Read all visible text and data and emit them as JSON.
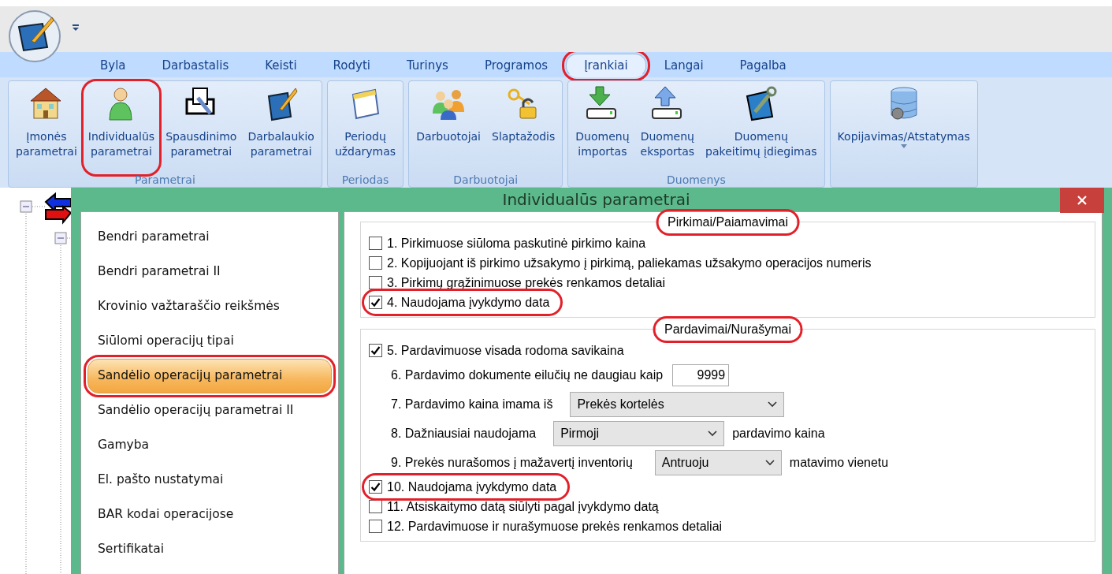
{
  "ribbon_tabs": [
    {
      "label": "Byla",
      "selected": false,
      "highlighted": false
    },
    {
      "label": "Darbastalis",
      "selected": false,
      "highlighted": false
    },
    {
      "label": "Keisti",
      "selected": false,
      "highlighted": false
    },
    {
      "label": "Rodyti",
      "selected": false,
      "highlighted": false
    },
    {
      "label": "Turinys",
      "selected": false,
      "highlighted": false
    },
    {
      "label": "Programos",
      "selected": false,
      "highlighted": false
    },
    {
      "label": "Įrankiai",
      "selected": true,
      "highlighted": true
    },
    {
      "label": "Langai",
      "selected": false,
      "highlighted": false
    },
    {
      "label": "Pagalba",
      "selected": false,
      "highlighted": false
    }
  ],
  "ribbon_groups": [
    {
      "label": "Parametrai",
      "buttons": [
        {
          "lines": [
            "Įmonės",
            "parametrai"
          ],
          "highlighted": false
        },
        {
          "lines": [
            "Individualūs",
            "parametrai"
          ],
          "highlighted": true
        },
        {
          "lines": [
            "Spausdinimo",
            "parametrai"
          ],
          "highlighted": false
        },
        {
          "lines": [
            "Darbalaukio",
            "parametrai"
          ],
          "highlighted": false
        }
      ]
    },
    {
      "label": "Periodas",
      "buttons": [
        {
          "lines": [
            "Periodų",
            "uždarymas"
          ],
          "highlighted": false
        }
      ]
    },
    {
      "label": "Darbuotojai",
      "buttons": [
        {
          "lines": [
            "Darbuotojai"
          ],
          "highlighted": false
        },
        {
          "lines": [
            "Slaptažodis"
          ],
          "highlighted": false
        }
      ]
    },
    {
      "label": "Duomenys",
      "buttons": [
        {
          "lines": [
            "Duomenų",
            "importas"
          ],
          "highlighted": false
        },
        {
          "lines": [
            "Duomenų",
            "eksportas"
          ],
          "highlighted": false
        },
        {
          "lines": [
            "Duomenų",
            "pakeitimų įdiegimas"
          ],
          "highlighted": false
        }
      ]
    },
    {
      "buttons": [
        {
          "lines": [
            "Kopijavimas/Atstatymas"
          ],
          "highlighted": false,
          "dropdown": true
        }
      ]
    }
  ],
  "dialog": {
    "title": "Individualūs parametrai",
    "sidebar": [
      {
        "label": "Bendri parametrai",
        "selected": false,
        "highlighted": false
      },
      {
        "label": "Bendri parametrai II",
        "selected": false,
        "highlighted": false
      },
      {
        "label": "Krovinio važtaraščio reikšmės",
        "selected": false,
        "highlighted": false
      },
      {
        "label": "Siūlomi operacijų tipai",
        "selected": false,
        "highlighted": false
      },
      {
        "label": "Sandėlio operacijų parametrai",
        "selected": true,
        "highlighted": true
      },
      {
        "label": "Sandėlio operacijų parametrai II",
        "selected": false,
        "highlighted": false
      },
      {
        "label": "Gamyba",
        "selected": false,
        "highlighted": false
      },
      {
        "label": "El. pašto nustatymai",
        "selected": false,
        "highlighted": false
      },
      {
        "label": "BAR kodai operacijose",
        "selected": false,
        "highlighted": false
      },
      {
        "label": "Sertifikatai",
        "selected": false,
        "highlighted": false
      }
    ],
    "groups": [
      {
        "legend": "Pirkimai/Paiamavimai",
        "highlighted": true,
        "rows": [
          {
            "kind": "checkbox",
            "label": "1. Pirkimuose siūloma paskutinė pirkimo kaina",
            "checked": false,
            "highlighted": false
          },
          {
            "kind": "checkbox",
            "label": "2. Kopijuojant iš pirkimo užsakymo į pirkimą, paliekamas užsakymo operacijos numeris",
            "checked": false,
            "highlighted": false
          },
          {
            "kind": "checkbox",
            "label": "3. Pirkimų grąžinimuose prekės renkamos detaliai",
            "checked": false,
            "highlighted": false
          },
          {
            "kind": "checkbox",
            "label": "4. Naudojama įvykdymo data",
            "checked": true,
            "highlighted": true
          }
        ]
      },
      {
        "legend": "Pardavimai/Nurašymai",
        "highlighted": true,
        "rows": [
          {
            "kind": "checkbox",
            "label": "5. Pardavimuose visada rodoma savikaina",
            "checked": true,
            "highlighted": false
          },
          {
            "kind": "number",
            "label": "6. Pardavimo dokumente eilučių ne daugiau kaip",
            "value": "9999"
          },
          {
            "kind": "select",
            "label": "7. Pardavimo kaina imama iš",
            "value": "Prekės kortelės"
          },
          {
            "kind": "select",
            "label": "8. Dažniausiai naudojama",
            "value": "Pirmoji",
            "suffix": "pardavimo kaina"
          },
          {
            "kind": "select",
            "label": "9. Prekės nurašomos į mažavertį inventorių",
            "value": "Antruoju",
            "suffix": "matavimo vienetu"
          },
          {
            "kind": "checkbox",
            "label": "10. Naudojama įvykdymo data",
            "checked": true,
            "highlighted": true
          },
          {
            "kind": "checkbox",
            "label": "11. Atsiskaitymo datą siūlyti pagal įvykdymo datą",
            "checked": false,
            "highlighted": false
          },
          {
            "kind": "checkbox",
            "label": "12. Pardavimuose ir nurašymuose prekės renkamos detaliai",
            "checked": false,
            "highlighted": false
          }
        ]
      }
    ]
  }
}
